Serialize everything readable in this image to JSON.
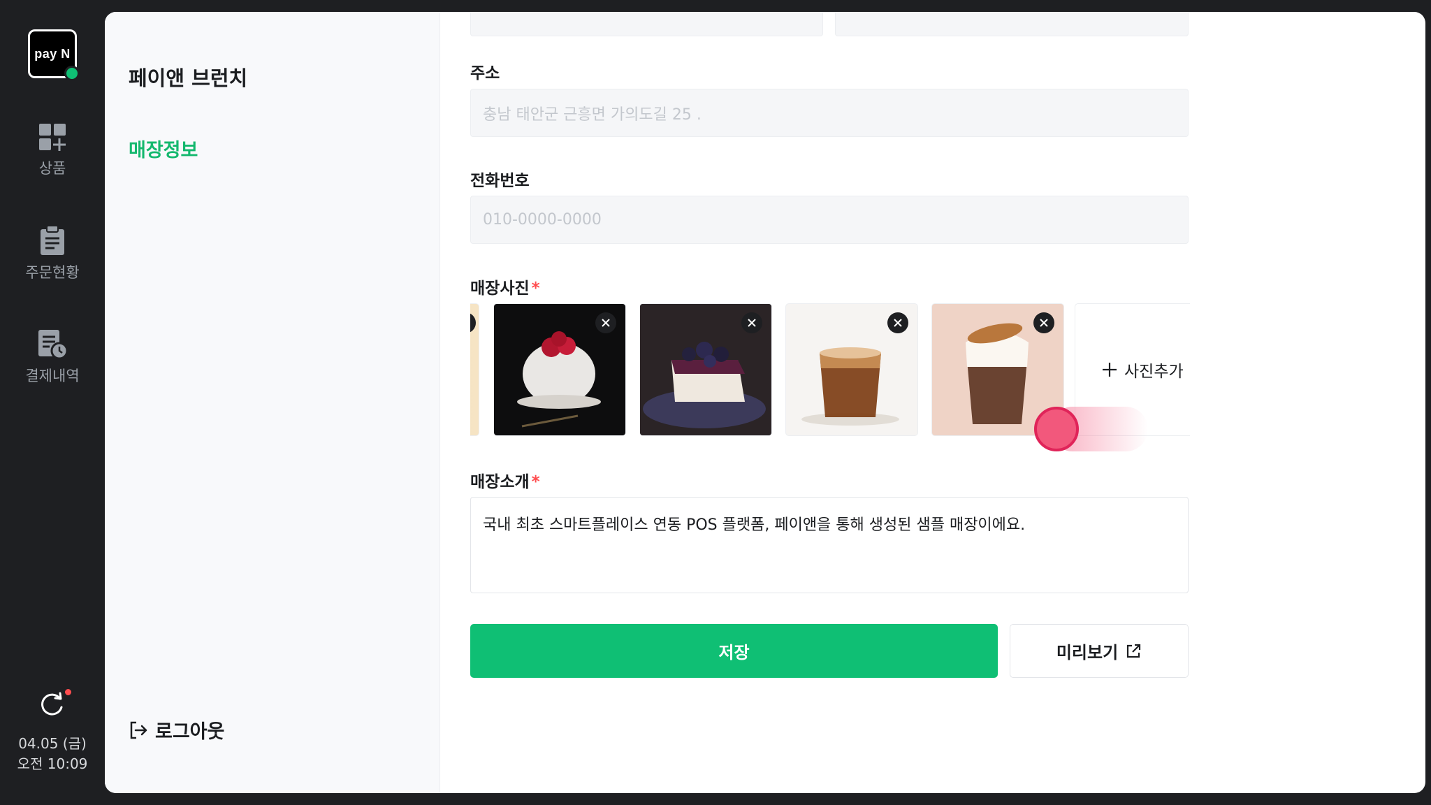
{
  "rail": {
    "logo_text": "pay N",
    "items": [
      {
        "label": "상품",
        "icon": "grid-plus-icon"
      },
      {
        "label": "주문현황",
        "icon": "clipboard-icon"
      },
      {
        "label": "결제내역",
        "icon": "receipt-clock-icon"
      }
    ],
    "date": "04.05 (금)",
    "time": "오전 10:09"
  },
  "side": {
    "store_name": "페이앤 브런치",
    "active_menu": "매장정보",
    "logout_label": "로그아웃"
  },
  "form": {
    "address_label": "주소",
    "address_placeholder": "충남 태안군 근흥면 가의도길 25 .",
    "phone_label": "전화번호",
    "phone_placeholder": "010-0000-0000",
    "photos_label": "매장사진",
    "photos": [
      "raspberry-cake",
      "blueberry-cheesecake",
      "iced-americano",
      "lotus-cream-latte"
    ],
    "add_photo_label": "사진추가",
    "intro_label": "매장소개",
    "intro_text": "국내 최초 스마트플레이스 연동 POS 플랫폼, 페이앤을 통해 생성된 샘플 매장이에요.",
    "save_label": "저장",
    "preview_label": "미리보기"
  },
  "colors": {
    "accent": "#0fbf74",
    "required": "#ff4d4f",
    "rail_bg": "#1e1f22"
  }
}
